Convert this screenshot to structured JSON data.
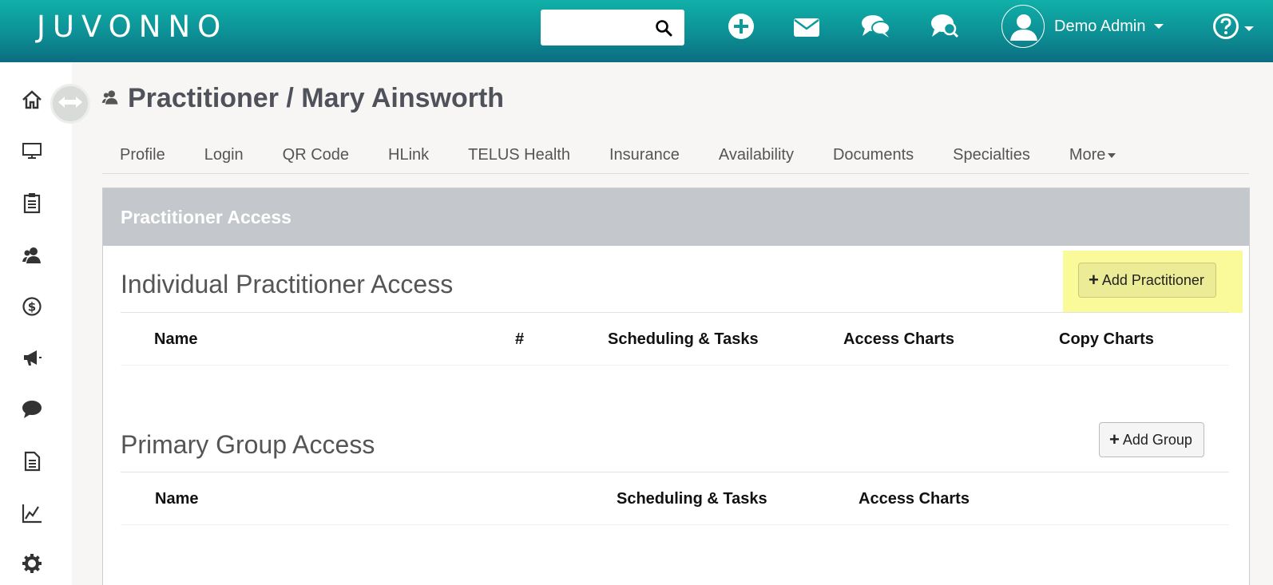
{
  "header": {
    "logo": "JUVONNO",
    "search_placeholder": "",
    "user_name": "Demo Admin",
    "icons": [
      "search-icon",
      "plus-circle-icon",
      "mail-icon",
      "chat-bubbles-icon",
      "chat-search-icon",
      "user-avatar-icon",
      "help-icon"
    ]
  },
  "sidebar": {
    "icons": [
      "home-icon",
      "monitor-icon",
      "clipboard-icon",
      "users-icon",
      "dollar-icon",
      "megaphone-icon",
      "chat-icon",
      "document-icon",
      "chart-icon",
      "settings-icon"
    ]
  },
  "page": {
    "title": "Practitioner / Mary Ainsworth"
  },
  "tabs": [
    "Profile",
    "Login",
    "QR Code",
    "HLink",
    "TELUS Health",
    "Insurance",
    "Availability",
    "Documents",
    "Specialties",
    "More"
  ],
  "panel": {
    "title": "Practitioner Access",
    "individual": {
      "title": "Individual Practitioner Access",
      "button": "Add Practitioner",
      "columns": [
        "Name",
        "#",
        "Scheduling & Tasks",
        "Access Charts",
        "Copy Charts"
      ]
    },
    "group": {
      "title": "Primary Group Access",
      "button": "Add Group",
      "columns": [
        "Name",
        "Scheduling & Tasks",
        "Access Charts"
      ]
    }
  },
  "colors": {
    "header_gradient_top": "#10b0a8",
    "header_gradient_bottom": "#0b6d80",
    "panel_header": "#c4c7cb",
    "highlight": "#fafa9a"
  }
}
